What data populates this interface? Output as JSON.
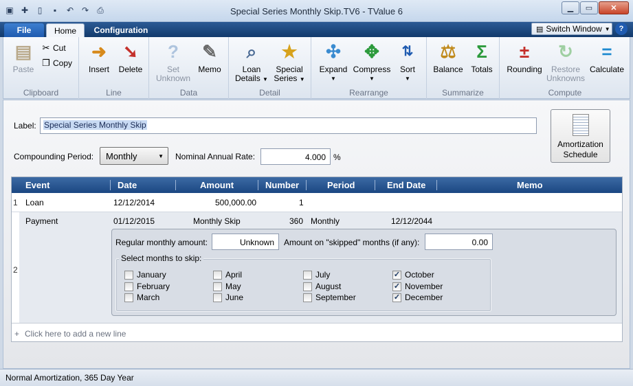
{
  "window": {
    "title": "Special Series Monthly Skip.TV6 - TValue 6"
  },
  "tabs": {
    "file": "File",
    "home": "Home",
    "configuration": "Configuration"
  },
  "toolbar": {
    "switch_window": "Switch Window",
    "help": "?"
  },
  "ribbon": {
    "clipboard": {
      "label": "Clipboard",
      "paste": "Paste",
      "cut": "Cut",
      "copy": "Copy"
    },
    "line": {
      "label": "Line",
      "insert": "Insert",
      "delete": "Delete"
    },
    "data": {
      "label": "Data",
      "set_unknown_1": "Set",
      "set_unknown_2": "Unknown",
      "memo": "Memo"
    },
    "detail": {
      "label": "Detail",
      "loan_details_1": "Loan",
      "loan_details_2": "Details",
      "special_series_1": "Special",
      "special_series_2": "Series"
    },
    "rearrange": {
      "label": "Rearrange",
      "expand": "Expand",
      "compress": "Compress",
      "sort": "Sort"
    },
    "summarize": {
      "label": "Summarize",
      "balance": "Balance",
      "totals": "Totals"
    },
    "compute": {
      "label": "Compute",
      "rounding": "Rounding",
      "restore_1": "Restore",
      "restore_2": "Unknowns",
      "calculate": "Calculate"
    }
  },
  "form": {
    "label_caption": "Label:",
    "label_value": "Special Series Monthly Skip",
    "compounding_caption": "Compounding Period:",
    "compounding_value": "Monthly",
    "rate_caption": "Nominal Annual Rate:",
    "rate_value": "4.000",
    "rate_unit": "%",
    "amortization_1": "Amortization",
    "amortization_2": "Schedule"
  },
  "grid": {
    "headers": {
      "event": "Event",
      "date": "Date",
      "amount": "Amount",
      "number": "Number",
      "period": "Period",
      "end_date": "End Date",
      "memo": "Memo"
    },
    "row1": {
      "num": "1",
      "event": "Loan",
      "date": "12/12/2014",
      "amount": "500,000.00",
      "number": "1"
    },
    "row2": {
      "num": "2",
      "event": "Payment",
      "date": "01/12/2015",
      "amount": "Monthly Skip",
      "number": "360",
      "period": "Monthly",
      "end_date": "12/12/2044"
    },
    "add_line": "Click here to add a new line",
    "add_plus": "+"
  },
  "skip": {
    "regular_caption": "Regular monthly amount:",
    "regular_value": "Unknown",
    "skipped_caption": "Amount on \"skipped\" months (if any):",
    "skipped_value": "0.00",
    "legend": "Select months to skip:",
    "months": [
      {
        "name": "January",
        "checked": false
      },
      {
        "name": "February",
        "checked": false
      },
      {
        "name": "March",
        "checked": false
      },
      {
        "name": "April",
        "checked": false
      },
      {
        "name": "May",
        "checked": false
      },
      {
        "name": "June",
        "checked": false
      },
      {
        "name": "July",
        "checked": false
      },
      {
        "name": "August",
        "checked": false
      },
      {
        "name": "September",
        "checked": false
      },
      {
        "name": "October",
        "checked": true
      },
      {
        "name": "November",
        "checked": true
      },
      {
        "name": "December",
        "checked": true
      }
    ]
  },
  "status": {
    "text": "Normal Amortization, 365 Day Year"
  }
}
